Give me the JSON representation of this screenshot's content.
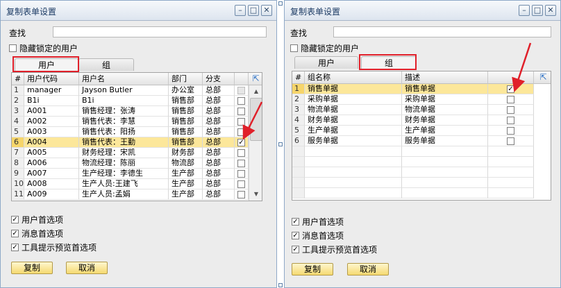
{
  "left": {
    "title": "复制表单设置",
    "search_label": "查找",
    "search_value": "",
    "hide_locked_label": "隐藏锁定的用户",
    "tabs": [
      "用户",
      "组"
    ],
    "columns": [
      "#",
      "用户代码",
      "用户名",
      "部门",
      "分支"
    ],
    "rows": [
      {
        "num": "1",
        "code": "manager",
        "name": "Jayson Butler",
        "dept": "办公室",
        "branch": "总部",
        "checked": false,
        "locked": true
      },
      {
        "num": "2",
        "code": "B1i",
        "name": "B1i",
        "dept": "销售部",
        "branch": "总部",
        "checked": false
      },
      {
        "num": "3",
        "code": "A001",
        "name": "销售经理：张涛",
        "dept": "销售部",
        "branch": "总部",
        "checked": false
      },
      {
        "num": "4",
        "code": "A002",
        "name": "销售代表：李慧",
        "dept": "销售部",
        "branch": "总部",
        "checked": false
      },
      {
        "num": "5",
        "code": "A003",
        "name": "销售代表：阳扬",
        "dept": "销售部",
        "branch": "总部",
        "checked": false
      },
      {
        "num": "6",
        "code": "A004",
        "name": "销售代表：王勤",
        "dept": "销售部",
        "branch": "总部",
        "checked": true,
        "selected": true
      },
      {
        "num": "7",
        "code": "A005",
        "name": "财务经理：宋凯",
        "dept": "财务部",
        "branch": "总部",
        "checked": false
      },
      {
        "num": "8",
        "code": "A006",
        "name": "物流经理：陈丽",
        "dept": "物流部",
        "branch": "总部",
        "checked": false
      },
      {
        "num": "9",
        "code": "A007",
        "name": "生产经理：李德生",
        "dept": "生产部",
        "branch": "总部",
        "checked": false
      },
      {
        "num": "10",
        "code": "A008",
        "name": "生产人员:王建飞",
        "dept": "生产部",
        "branch": "总部",
        "checked": false
      },
      {
        "num": "11",
        "code": "A009",
        "name": "生产人员:孟娟",
        "dept": "生产部",
        "branch": "总部",
        "checked": false
      }
    ],
    "options": [
      {
        "label": "用户首选项",
        "checked": true
      },
      {
        "label": "消息首选项",
        "checked": true
      },
      {
        "label": "工具提示预览首选项",
        "checked": true
      }
    ],
    "copy_label": "复制",
    "cancel_label": "取消"
  },
  "right": {
    "title": "复制表单设置",
    "search_label": "查找",
    "search_value": "",
    "hide_locked_label": "隐藏锁定的用户",
    "tabs": [
      "用户",
      "组"
    ],
    "columns": [
      "#",
      "组名称",
      "描述"
    ],
    "rows": [
      {
        "num": "1",
        "name": "销售单据",
        "desc": "销售单据",
        "checked": true,
        "selected": true
      },
      {
        "num": "2",
        "name": "采购单据",
        "desc": "采购单据",
        "checked": false
      },
      {
        "num": "3",
        "name": "物流单据",
        "desc": "物流单据",
        "checked": false
      },
      {
        "num": "4",
        "name": "财务单据",
        "desc": "财务单据",
        "checked": false
      },
      {
        "num": "5",
        "name": "生产单据",
        "desc": "生产单据",
        "checked": false
      },
      {
        "num": "6",
        "name": "服务单据",
        "desc": "服务单据",
        "checked": false
      }
    ],
    "options": [
      {
        "label": "用户首选项",
        "checked": true
      },
      {
        "label": "消息首选项",
        "checked": true
      },
      {
        "label": "工具提示预览首选项",
        "checked": true
      }
    ],
    "copy_label": "复制",
    "cancel_label": "取消"
  },
  "icons": {
    "minimize": "minimize-icon",
    "maximize": "maximize-icon",
    "close": "close-icon",
    "expand": "expand-icon",
    "checkmark": "✓"
  },
  "colors": {
    "selected_row": "#fce79a",
    "highlight_box": "#e0202a",
    "button": "#f5d970"
  }
}
